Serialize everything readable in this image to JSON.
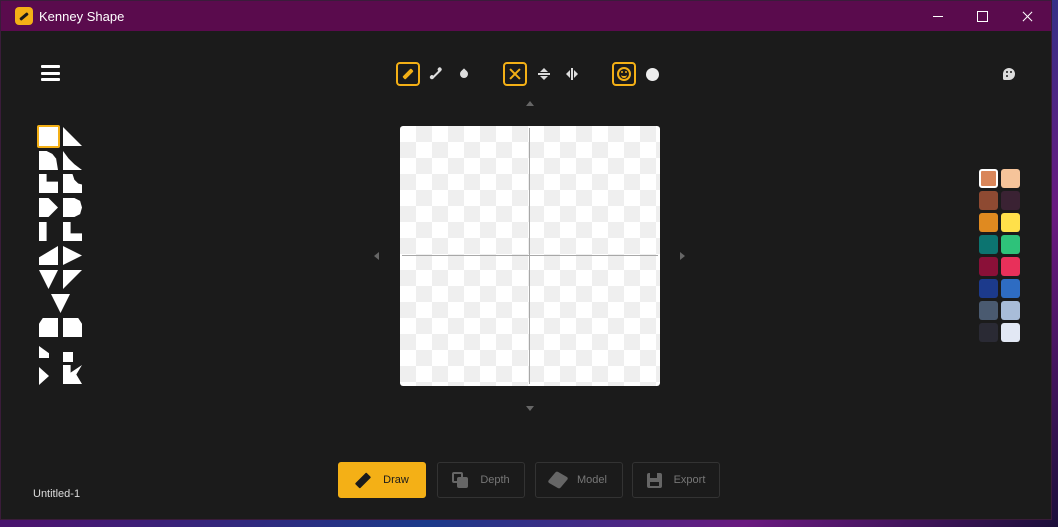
{
  "window": {
    "title": "Kenney Shape"
  },
  "tools": {
    "draw_tools": [
      "pencil-icon",
      "line-icon",
      "fill-icon"
    ],
    "transform_tools": [
      "clear-icon",
      "flip-vertical-icon",
      "flip-horizontal-icon"
    ],
    "style_tools": [
      "smiley-icon",
      "circle-icon"
    ],
    "active": [
      "pencil",
      "clear",
      "smiley"
    ]
  },
  "shapes": {
    "count": 24,
    "selected_index": 0
  },
  "palette": {
    "colors": [
      "#d9865a",
      "#f6c49a",
      "#8e4a32",
      "#3a2233",
      "#e08a20",
      "#ffe04a",
      "#0c7470",
      "#2ec27a",
      "#8a1038",
      "#e8305a",
      "#1c3a8c",
      "#2e6cc2",
      "#4a5a70",
      "#a8bcd8",
      "#2a2a34",
      "#e2e8f4"
    ],
    "selected": 0,
    "accent": "#f4b016"
  },
  "modes": {
    "draw": "Draw",
    "depth": "Depth",
    "model": "Model",
    "export": "Export",
    "active": "draw"
  },
  "file": {
    "name": "Untitled-1"
  }
}
